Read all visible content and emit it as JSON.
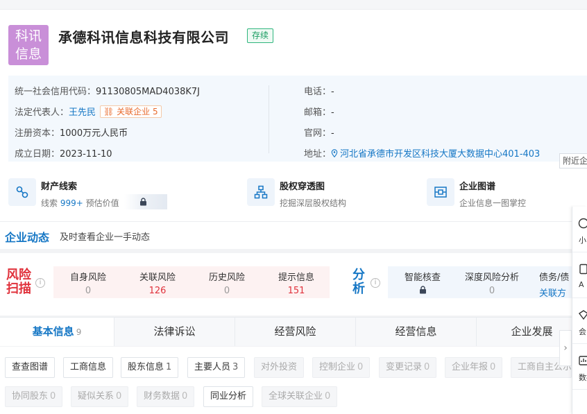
{
  "company": {
    "logo_line1": "科讯",
    "logo_line2": "信息",
    "name": "承德科讯信息科技有限公司",
    "status": "存续"
  },
  "info": {
    "credit_code_label": "统一社会信用代码：",
    "credit_code": "91130805MAD4038K7J",
    "legal_rep_label": "法定代表人：",
    "legal_rep": "王先民",
    "related_label": "关联企业",
    "related_count": "5",
    "capital_label": "注册资本：",
    "capital": "1000万元人民币",
    "founded_label": "成立日期：",
    "founded": "2023-11-10",
    "phone_label": "电话：",
    "phone": "-",
    "email_label": "邮箱：",
    "email": "-",
    "website_label": "官网：",
    "website": "-",
    "address_label": "地址：",
    "address": "河北省承德市开发区科技大厦大数据中心401-403",
    "nearby_label": "附近企业"
  },
  "features": [
    {
      "title": "财产线索",
      "sub_prefix": "线索 ",
      "sub_count": "999+",
      "sub_suffix": " 预估价值"
    },
    {
      "title": "股权穿透图",
      "sub": "挖掘深层股权结构"
    },
    {
      "title": "企业图谱",
      "sub": "企业信息一图掌控"
    }
  ],
  "dynamics": {
    "title": "企业动态",
    "subtitle": "及时查看企业一手动态"
  },
  "risk": {
    "label_line1": "风险",
    "label_line2": "扫描",
    "items": [
      {
        "label": "自身风险",
        "value": "0"
      },
      {
        "label": "关联风险",
        "value": "126"
      },
      {
        "label": "历史风险",
        "value": "0"
      },
      {
        "label": "提示信息",
        "value": "151"
      }
    ]
  },
  "analysis": {
    "label_line1": "分",
    "label_line2": "析",
    "items": [
      {
        "label": "智能核查"
      },
      {
        "label": "深度风险分析",
        "value": "0"
      },
      {
        "label": "债务/债",
        "value": "关联方"
      }
    ]
  },
  "tabs": [
    {
      "label": "基本信息",
      "count": "9"
    },
    {
      "label": "法律诉讼"
    },
    {
      "label": "经营风险"
    },
    {
      "label": "经营信息"
    },
    {
      "label": "企业发展"
    }
  ],
  "chips_row1": [
    {
      "label": "查查图谱",
      "count": ""
    },
    {
      "label": "工商信息",
      "count": ""
    },
    {
      "label": "股东信息",
      "count": "1"
    },
    {
      "label": "主要人员",
      "count": "3"
    },
    {
      "label": "对外投资",
      "count": ""
    },
    {
      "label": "控制企业",
      "count": "0"
    },
    {
      "label": "变更记录",
      "count": "0"
    },
    {
      "label": "企业年报",
      "count": "0"
    },
    {
      "label": "工商自主公示",
      "count": ""
    }
  ],
  "chips_row2": [
    {
      "label": "协同股东",
      "count": "0"
    },
    {
      "label": "疑似关系",
      "count": "0"
    },
    {
      "label": "财务数据",
      "count": "0"
    },
    {
      "label": "同业分析",
      "count": ""
    },
    {
      "label": "全球关联企业",
      "count": "0"
    }
  ],
  "side_tools": [
    {
      "label": "小"
    },
    {
      "label": "A"
    },
    {
      "label": "会"
    },
    {
      "label": "数据"
    }
  ],
  "colors": {
    "brand_blue": "#1677c5",
    "risk_red": "#e0313b",
    "status_green": "#1a9c61",
    "logo_purple": "#c98fd8"
  }
}
